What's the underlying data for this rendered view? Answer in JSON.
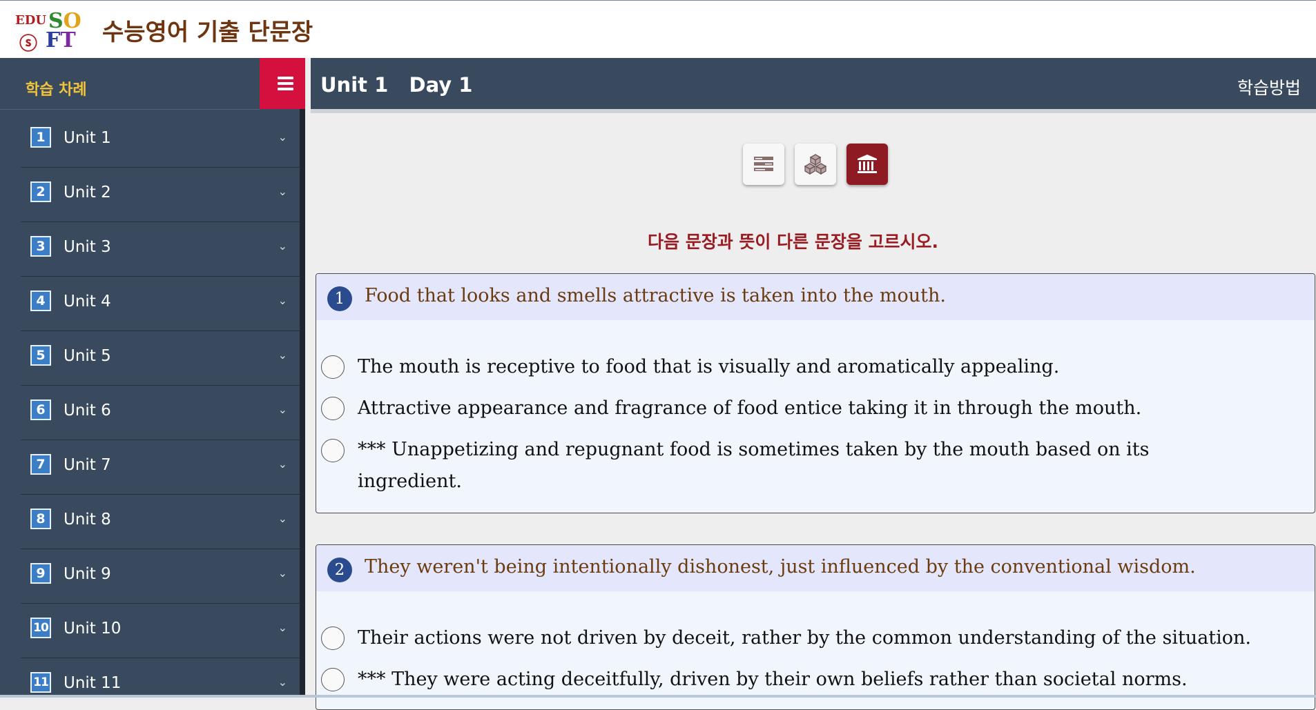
{
  "header": {
    "logo": {
      "part1": "EDU",
      "part2": "SO",
      "part3": "ⓢ",
      "part4": "FT"
    },
    "app_title": "수능영어 기출 단문장"
  },
  "sidebar": {
    "title": "학습 차례",
    "menu_icon": "hamburger-icon",
    "units": [
      {
        "num": "1",
        "label": "Unit 1"
      },
      {
        "num": "2",
        "label": "Unit 2"
      },
      {
        "num": "3",
        "label": "Unit 3"
      },
      {
        "num": "4",
        "label": "Unit 4"
      },
      {
        "num": "5",
        "label": "Unit 5"
      },
      {
        "num": "6",
        "label": "Unit 6"
      },
      {
        "num": "7",
        "label": "Unit 7"
      },
      {
        "num": "8",
        "label": "Unit 8"
      },
      {
        "num": "9",
        "label": "Unit 9"
      },
      {
        "num": "10",
        "label": "Unit 10"
      },
      {
        "num": "11",
        "label": "Unit 11"
      }
    ]
  },
  "content": {
    "title": "Unit 1   Day 1",
    "study_method": "학습방법",
    "mode_buttons": [
      {
        "icon": "list-icon",
        "active": false
      },
      {
        "icon": "cubes-icon",
        "active": false
      },
      {
        "icon": "bank-icon",
        "active": true
      }
    ],
    "instruction": "다음 문장과 뜻이 다른 문장을 고르시오.",
    "questions": [
      {
        "num": "1",
        "text": "Food that looks and smells attractive is taken into the mouth.",
        "options": [
          "The mouth is receptive to food that is visually and aromatically appealing.",
          "Attractive appearance and fragrance of food entice taking it in through the mouth.",
          "*** Unappetizing and repugnant food is sometimes taken by the mouth based on its ingredient."
        ]
      },
      {
        "num": "2",
        "text": "They weren't being intentionally dishonest, just influenced by the conventional wisdom.",
        "options": [
          "Their actions were not driven by deceit, rather by the common understanding of the situation.",
          "*** They were acting deceitfully, driven by their own beliefs rather than societal norms."
        ]
      }
    ]
  }
}
